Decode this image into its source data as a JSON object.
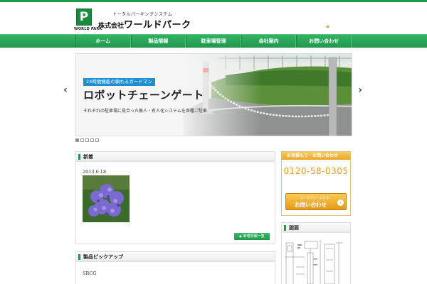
{
  "header": {
    "logo_letter": "P",
    "logo_english": "WORLD PARK",
    "tagline": "トータルパーキングシステム",
    "company_prefix": "株式会社",
    "company_name": "ワールドパーク"
  },
  "nav": {
    "items": [
      {
        "label": "ホーム"
      },
      {
        "label": "製品情報"
      },
      {
        "label": "駐車場管理"
      },
      {
        "label": "会社案内"
      },
      {
        "label": "お問い合わせ"
      }
    ]
  },
  "hero": {
    "tag": "24時間機能の頼れるガードマン",
    "title": "ロボットチェーンゲート",
    "description": "それぞれの駐車場に見合った無人・有人化システムを各種ご駐車",
    "prev_symbol": "‹",
    "next_symbol": "›",
    "slide_count": 5,
    "active_slide": 1
  },
  "news": {
    "heading": "新着",
    "date": "2013 6 18",
    "more_button": "新着情報一覧"
  },
  "pickup": {
    "heading": "製品ピックアップ",
    "code": "SRCG"
  },
  "contact": {
    "heading": "お見積もり・お問い合わせ",
    "phone": "0120-58-0305",
    "form_small": "メールフォームから",
    "form_big": "お問い合わせ",
    "form_arrow": "›"
  },
  "drawing": {
    "heading": "図面"
  },
  "colors": {
    "brand_green": "#1f9a4c",
    "accent_orange": "#e89a1c",
    "tag_blue": "#1c8fd0"
  }
}
